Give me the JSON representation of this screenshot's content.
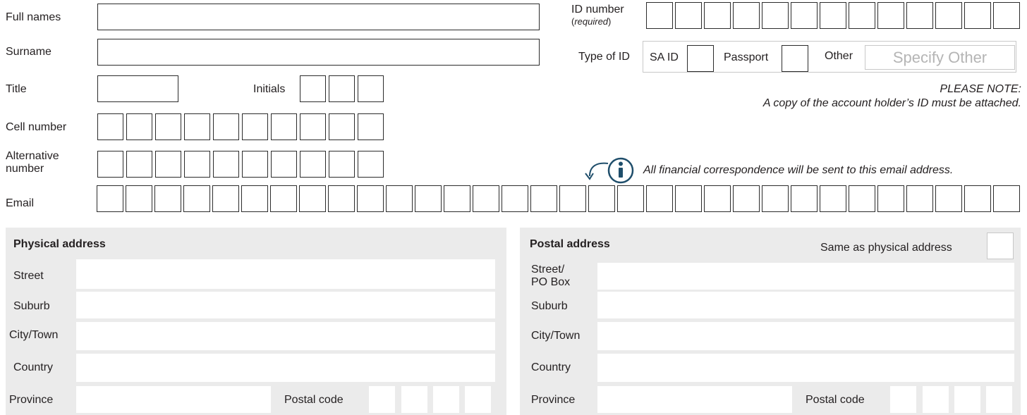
{
  "personal": {
    "full_names_label": "Full names",
    "surname_label": "Surname",
    "title_label": "Title",
    "initials_label": "Initials",
    "cell_number_label": "Cell number",
    "alt_number_label_1": "Alternative",
    "alt_number_label_2": "number",
    "email_label": "Email"
  },
  "id": {
    "id_number_label": "ID number",
    "required_label": "required",
    "type_of_id_label": "Type of ID",
    "sa_id_label": "SA ID",
    "passport_label": "Passport",
    "other_label": "Other",
    "specify_placeholder": "Specify Other",
    "note_line1": "PLEASE NOTE:",
    "note_line2": "A copy of the account holder’s ID must be attached."
  },
  "email_note": "All financial correspondence will be sent to this email address.",
  "physical": {
    "heading": "Physical address",
    "street_label": "Street",
    "suburb_label": "Suburb",
    "city_label": "City/Town",
    "country_label": "Country",
    "province_label": "Province",
    "postal_code_label": "Postal code"
  },
  "postal": {
    "heading": "Postal address",
    "same_as_label": "Same as physical address",
    "street_label_1": "Street/",
    "street_label_2": "PO Box",
    "suburb_label": "Suburb",
    "city_label": "City/Town",
    "country_label": "Country",
    "province_label": "Province",
    "postal_code_label": "Postal code"
  },
  "icons": {
    "info": "info-icon",
    "arrow": "curved-arrow-icon"
  },
  "colors": {
    "info_icon": "#1f4e6b",
    "panel_bg": "#ebebeb",
    "placeholder": "#b5b5b5"
  }
}
